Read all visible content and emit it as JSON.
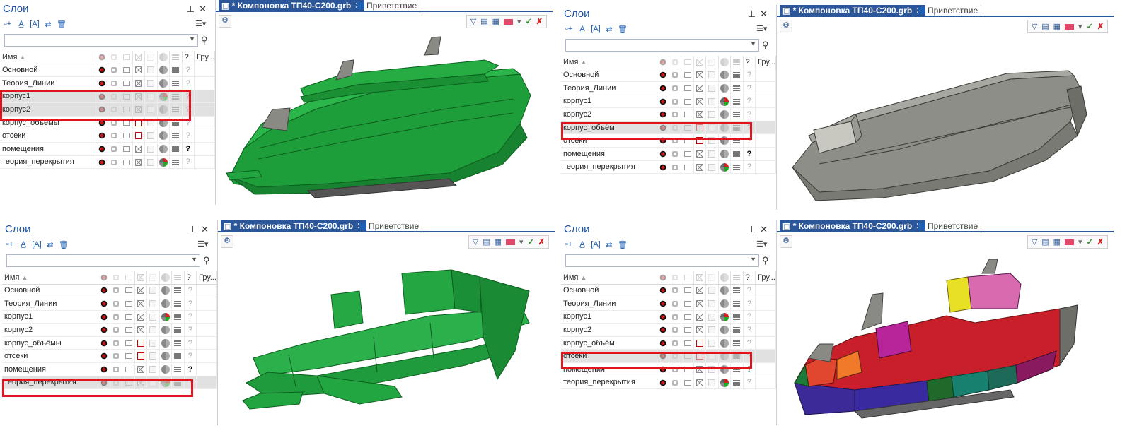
{
  "panel": {
    "title": "Слои",
    "column_name": "Имя",
    "column_group": "Гру...",
    "pin_icon": "pin-icon",
    "close_icon": "close-icon"
  },
  "document": {
    "active_tab": "* Компоновка ТП40-С200.grb",
    "welcome_tab": "Приветствие"
  },
  "colors": {
    "accent": "#2b579a",
    "highlight": "#e0141e",
    "hull_green": "#1fa03a",
    "hull_grey": "#8c8c86"
  },
  "quadrants": [
    {
      "layers": [
        {
          "name": "Основной",
          "cut": "gray",
          "color": "gray",
          "q": "light"
        },
        {
          "name": "Теория_Линии",
          "cut": "gray",
          "color": "gray",
          "q": "light"
        },
        {
          "name": "корпус1",
          "cut": "gray",
          "color": "color",
          "q": "light",
          "selected": true,
          "dim": true
        },
        {
          "name": "корпус2",
          "cut": "gray",
          "color": "gray",
          "q": "light",
          "selected": true,
          "dim": true
        },
        {
          "name": "корпус_объёмы",
          "cut": "red",
          "color": "gray",
          "q": "light"
        },
        {
          "name": "отсеки",
          "cut": "red",
          "color": "gray",
          "q": "light"
        },
        {
          "name": "помещения",
          "cut": "gray",
          "color": "gray",
          "q": "bold"
        },
        {
          "name": "теория_перекрытия",
          "cut": "gray",
          "color": "color",
          "q": "light"
        }
      ],
      "model": "green-full-hull"
    },
    {
      "layers": [
        {
          "name": "Основной",
          "cut": "gray",
          "color": "gray",
          "q": "light"
        },
        {
          "name": "Теория_Линии",
          "cut": "gray",
          "color": "gray",
          "q": "light"
        },
        {
          "name": "корпус1",
          "cut": "gray",
          "color": "color",
          "q": "light"
        },
        {
          "name": "корпус2",
          "cut": "gray",
          "color": "gray",
          "q": "light"
        },
        {
          "name": "корпус_объём",
          "cut": "red",
          "color": "gray",
          "q": "light",
          "selected": true,
          "dim": true
        },
        {
          "name": "отсеки",
          "cut": "red",
          "color": "gray",
          "q": "light"
        },
        {
          "name": "помещения",
          "cut": "gray",
          "color": "gray",
          "q": "bold"
        },
        {
          "name": "теория_перекрытия",
          "cut": "gray",
          "color": "color",
          "q": "light"
        }
      ],
      "model": "grey-volume-hull"
    },
    {
      "layers": [
        {
          "name": "Основной",
          "cut": "gray",
          "color": "gray",
          "q": "light"
        },
        {
          "name": "Теория_Линии",
          "cut": "gray",
          "color": "gray",
          "q": "light"
        },
        {
          "name": "корпус1",
          "cut": "gray",
          "color": "color",
          "q": "light"
        },
        {
          "name": "корпус2",
          "cut": "gray",
          "color": "gray",
          "q": "light"
        },
        {
          "name": "корпус_объёмы",
          "cut": "red",
          "color": "gray",
          "q": "light"
        },
        {
          "name": "отсеки",
          "cut": "red",
          "color": "gray",
          "q": "light"
        },
        {
          "name": "помещения",
          "cut": "gray",
          "color": "gray",
          "q": "bold"
        },
        {
          "name": "теория_перекрытия",
          "cut": "gray",
          "color": "color",
          "q": "light",
          "selected": true,
          "dim": true
        }
      ],
      "model": "green-decks"
    },
    {
      "layers": [
        {
          "name": "Основной",
          "cut": "gray",
          "color": "gray",
          "q": "light"
        },
        {
          "name": "Теория_Линии",
          "cut": "gray",
          "color": "gray",
          "q": "light"
        },
        {
          "name": "корпус1",
          "cut": "gray",
          "color": "color",
          "q": "light"
        },
        {
          "name": "корпус2",
          "cut": "gray",
          "color": "gray",
          "q": "light"
        },
        {
          "name": "корпус_объём",
          "cut": "red",
          "color": "gray",
          "q": "light"
        },
        {
          "name": "отсеки",
          "cut": "red",
          "color": "gray",
          "q": "light",
          "selected": true,
          "dim": true
        },
        {
          "name": "помещения",
          "cut": "gray",
          "color": "gray",
          "q": "bold"
        },
        {
          "name": "теория_перекрытия",
          "cut": "gray",
          "color": "color",
          "q": "light"
        }
      ],
      "model": "colored-compartments"
    }
  ]
}
